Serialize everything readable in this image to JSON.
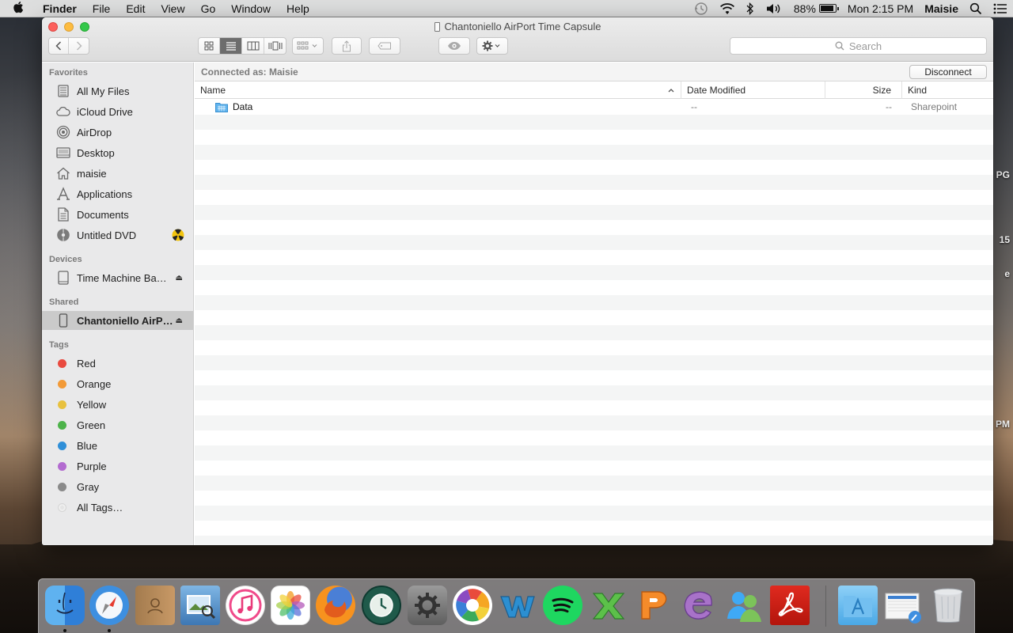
{
  "menubar": {
    "app_name": "Finder",
    "menus": [
      "File",
      "Edit",
      "View",
      "Go",
      "Window",
      "Help"
    ],
    "battery_percent": "88%",
    "battery_level": 0.88,
    "clock": "Mon 2:15 PM",
    "user": "Maisie"
  },
  "window": {
    "title": "Chantoniello AirPort Time Capsule",
    "search_placeholder": "Search"
  },
  "sidebar": {
    "favorites_header": "Favorites",
    "favorites": [
      {
        "label": "All My Files",
        "icon": "all-files-icon"
      },
      {
        "label": "iCloud Drive",
        "icon": "cloud-icon"
      },
      {
        "label": "AirDrop",
        "icon": "airdrop-icon"
      },
      {
        "label": "Desktop",
        "icon": "desktop-icon"
      },
      {
        "label": "maisie",
        "icon": "home-icon"
      },
      {
        "label": "Applications",
        "icon": "applications-icon"
      },
      {
        "label": "Documents",
        "icon": "documents-icon"
      },
      {
        "label": "Untitled DVD",
        "icon": "dvd-icon"
      }
    ],
    "devices_header": "Devices",
    "devices": [
      {
        "label": "Time Machine Ba…",
        "icon": "drive-icon"
      }
    ],
    "shared_header": "Shared",
    "shared": [
      {
        "label": "Chantoniello AirP…",
        "icon": "time-capsule-icon"
      }
    ],
    "tags_header": "Tags",
    "tags": [
      {
        "label": "Red",
        "color": "#e94a3f"
      },
      {
        "label": "Orange",
        "color": "#f29a38"
      },
      {
        "label": "Yellow",
        "color": "#e8c13f"
      },
      {
        "label": "Green",
        "color": "#4db34a"
      },
      {
        "label": "Blue",
        "color": "#2f8fd8"
      },
      {
        "label": "Purple",
        "color": "#b36bd0"
      },
      {
        "label": "Gray",
        "color": "#8a8a8a"
      },
      {
        "label": "All Tags…",
        "color": "#d6d6d6"
      }
    ]
  },
  "content": {
    "connected_as": "Connected as: Maisie",
    "disconnect_label": "Disconnect",
    "columns": [
      "Name",
      "Date Modified",
      "Size",
      "Kind"
    ],
    "files": [
      {
        "name": "Data",
        "date_modified": "--",
        "size": "--",
        "kind": "Sharepoint"
      }
    ]
  },
  "desktop": {
    "peek_labels": [
      "PG",
      "15",
      "e",
      "PM"
    ]
  },
  "dock": {
    "apps": [
      "Finder",
      "Safari",
      "Contacts",
      "Preview",
      "iTunes",
      "Photos",
      "Firefox",
      "Time Machine",
      "System Preferences",
      "Picasa",
      "Word",
      "Spotify",
      "Excel",
      "PowerPoint",
      "Entourage",
      "Messenger",
      "Acrobat",
      "Applications",
      "Downloads",
      "Trash"
    ]
  }
}
